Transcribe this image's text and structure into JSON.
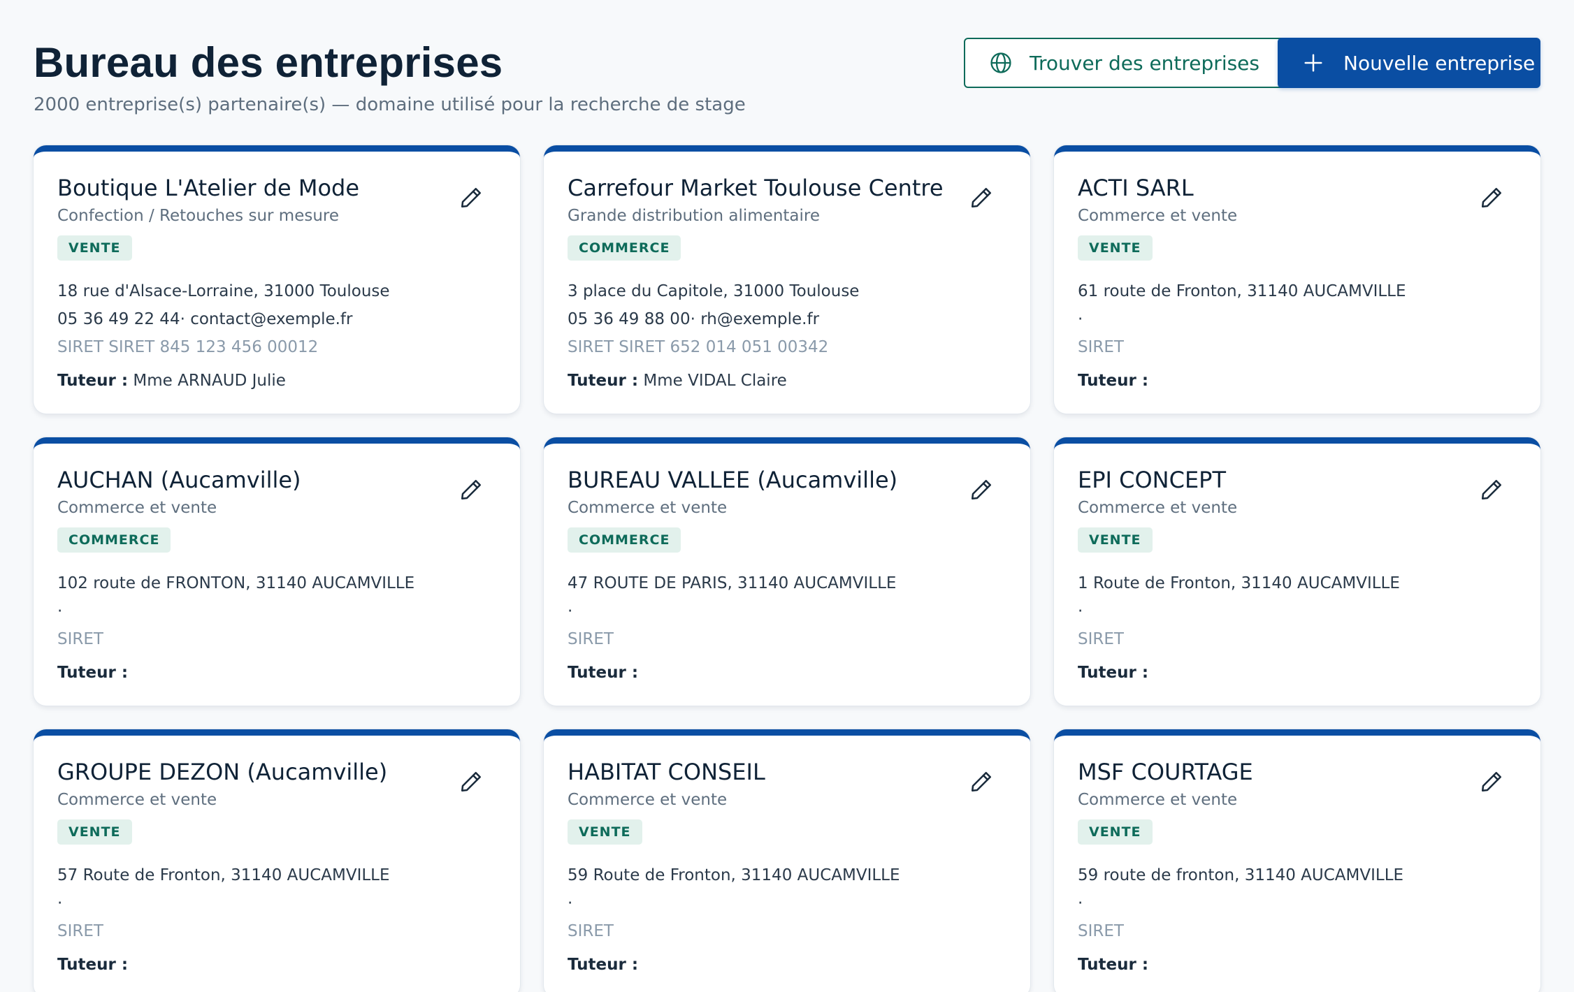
{
  "header": {
    "title": "Bureau des entreprises",
    "subtitle": "2000 entreprise(s) partenaire(s) — domaine utilisé pour la recherche de stage",
    "find_button_label": "Trouver des entreprises",
    "new_button_label": "Nouvelle entreprise"
  },
  "colors": {
    "primary": "#0a4ea3",
    "accent_green": "#0e6b5a",
    "badge_bg": "#e2f1ec",
    "muted_text": "#5e6e7e"
  },
  "icons": {
    "find_button": "globe-icon",
    "new_button": "plus-icon",
    "card_edit": "pencil-icon"
  },
  "tutor_label": "Tuteur :",
  "companies": [
    {
      "name": "Boutique L'Atelier de Mode",
      "activity": "Confection / Retouches sur mesure",
      "badge": "VENTE",
      "address": "18 rue d'Alsace-Lorraine, 31000 Toulouse",
      "contact": "05 36 49 22 44· contact@exemple.fr",
      "siret": "SIRET SIRET 845 123 456 00012",
      "tutor": "Mme ARNAUD Julie"
    },
    {
      "name": "Carrefour Market Toulouse Centre",
      "activity": "Grande distribution alimentaire",
      "badge": "COMMERCE",
      "address": "3 place du Capitole, 31000 Toulouse",
      "contact": "05 36 49 88 00· rh@exemple.fr",
      "siret": "SIRET SIRET 652 014 051 00342",
      "tutor": "Mme VIDAL Claire"
    },
    {
      "name": "ACTI SARL",
      "activity": "Commerce et vente",
      "badge": "VENTE",
      "address": "61 route de Fronton, 31140 AUCAMVILLE",
      "contact": "·",
      "siret": "SIRET",
      "tutor": ""
    },
    {
      "name": "AUCHAN (Aucamville)",
      "activity": "Commerce et vente",
      "badge": "COMMERCE",
      "address": "102 route de FRONTON, 31140 AUCAMVILLE",
      "contact": "·",
      "siret": "SIRET",
      "tutor": ""
    },
    {
      "name": "BUREAU VALLEE (Aucamville)",
      "activity": "Commerce et vente",
      "badge": "COMMERCE",
      "address": "47 ROUTE DE PARIS, 31140 AUCAMVILLE",
      "contact": "·",
      "siret": "SIRET",
      "tutor": ""
    },
    {
      "name": "EPI CONCEPT",
      "activity": "Commerce et vente",
      "badge": "VENTE",
      "address": "1 Route de Fronton, 31140 AUCAMVILLE",
      "contact": "·",
      "siret": "SIRET",
      "tutor": ""
    },
    {
      "name": "GROUPE DEZON (Aucamville)",
      "activity": "Commerce et vente",
      "badge": "VENTE",
      "address": "57 Route de Fronton, 31140 AUCAMVILLE",
      "contact": "·",
      "siret": "SIRET",
      "tutor": ""
    },
    {
      "name": "HABITAT CONSEIL",
      "activity": "Commerce et vente",
      "badge": "VENTE",
      "address": "59 Route de Fronton, 31140 AUCAMVILLE",
      "contact": "·",
      "siret": "SIRET",
      "tutor": ""
    },
    {
      "name": "MSF COURTAGE",
      "activity": "Commerce et vente",
      "badge": "VENTE",
      "address": "59 route de fronton, 31140 AUCAMVILLE",
      "contact": "·",
      "siret": "SIRET",
      "tutor": ""
    }
  ]
}
